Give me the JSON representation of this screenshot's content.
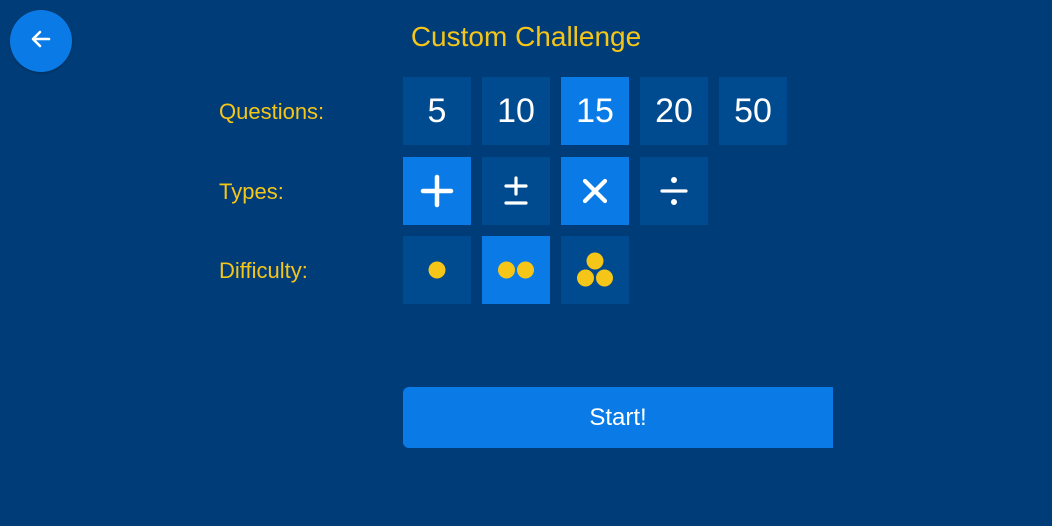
{
  "header": {
    "title": "Custom Challenge",
    "back_icon": "arrow-left-icon"
  },
  "colors": {
    "background": "#003d78",
    "tile": "#004a8f",
    "tile_selected": "#0a7be6",
    "accent_text": "#f5c518",
    "dot": "#f5c518"
  },
  "questions": {
    "label": "Questions:",
    "options": [
      {
        "value": "5",
        "selected": false
      },
      {
        "value": "10",
        "selected": false
      },
      {
        "value": "15",
        "selected": true
      },
      {
        "value": "20",
        "selected": false
      },
      {
        "value": "50",
        "selected": false
      }
    ]
  },
  "types": {
    "label": "Types:",
    "options": [
      {
        "icon": "plus-icon",
        "selected": true
      },
      {
        "icon": "plus-minus-icon",
        "selected": false
      },
      {
        "icon": "multiply-icon",
        "selected": true
      },
      {
        "icon": "divide-icon",
        "selected": false
      }
    ]
  },
  "difficulty": {
    "label": "Difficulty:",
    "options": [
      {
        "icon": "one-dot-icon",
        "level": 1,
        "selected": false
      },
      {
        "icon": "two-dots-icon",
        "level": 2,
        "selected": true
      },
      {
        "icon": "three-dots-icon",
        "level": 3,
        "selected": false
      }
    ]
  },
  "actions": {
    "start_label": "Start!"
  }
}
